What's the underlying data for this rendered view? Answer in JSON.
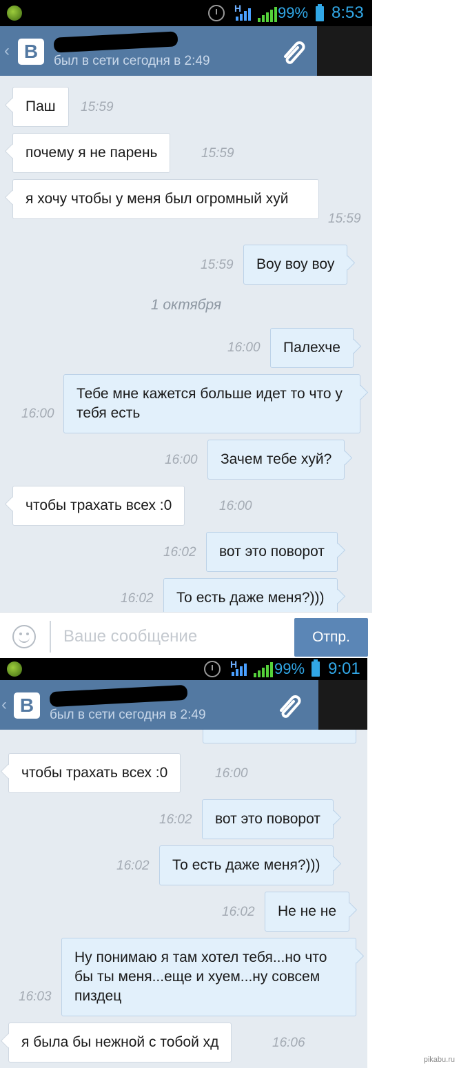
{
  "screen1": {
    "status": {
      "network": "H",
      "battery": "99%",
      "time": "8:53"
    },
    "header": {
      "back": "‹",
      "logo": "B",
      "last_seen": "был в сети сегодня в 2:49"
    },
    "messages": [
      {
        "text": "Паш",
        "time": "15:59"
      },
      {
        "text": "почему я не парень",
        "time": "15:59"
      },
      {
        "text": "я хочу чтобы у меня был огромный хуй",
        "time": "15:59"
      },
      {
        "text": "Воу воу воу",
        "time": "15:59"
      },
      {
        "text": "Палехче",
        "time": "16:00"
      },
      {
        "text": "Тебе мне кажется больше идет то что у тебя есть",
        "time": "16:00"
      },
      {
        "text": "Зачем тебе хуй?",
        "time": "16:00"
      },
      {
        "text": "чтобы трахать всех :0",
        "time": "16:00"
      },
      {
        "text": "вот это поворот",
        "time": "16:02"
      },
      {
        "text": "То есть даже меня?)))",
        "time": "16:02"
      }
    ],
    "date_separator": "1 октября",
    "composer": {
      "placeholder": "Ваше сообщение",
      "send_label": "Отпр."
    }
  },
  "screen2": {
    "status": {
      "network": "H",
      "battery": "99%",
      "time": "9:01"
    },
    "header": {
      "back": "‹",
      "logo": "B",
      "last_seen": "был в сети сегодня в 2:49"
    },
    "messages": [
      {
        "text": "чтобы трахать всех :0",
        "time": "16:00"
      },
      {
        "text": "вот это поворот",
        "time": "16:02"
      },
      {
        "text": "То есть даже меня?)))",
        "time": "16:02"
      },
      {
        "text": "Не не не",
        "time": "16:02"
      },
      {
        "text": "Ну понимаю я там хотел тебя...но что бы ты меня...еще и хуем...ну совсем пиздец",
        "time": "16:03"
      },
      {
        "text": "я была бы нежной с тобой хд",
        "time": "16:06"
      }
    ]
  },
  "watermark": "pikabu.ru"
}
